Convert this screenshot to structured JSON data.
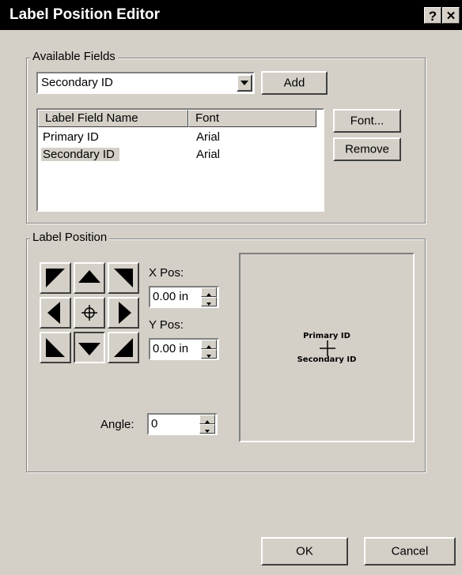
{
  "window": {
    "title": "Label Position Editor",
    "help_label": "?",
    "close_label": "✕"
  },
  "available_fields": {
    "group_label": "Available Fields",
    "selected": "Secondary ID",
    "add_label": "Add",
    "columns": [
      "Label Field Name",
      "Font"
    ],
    "rows": [
      {
        "name": "Primary ID",
        "font": "Arial"
      },
      {
        "name": "Secondary ID",
        "font": "Arial"
      }
    ],
    "font_button": "Font...",
    "remove_button": "Remove"
  },
  "label_position": {
    "group_label": "Label Position",
    "x_pos_label": "X Pos:",
    "x_pos_value": "0.00 in",
    "y_pos_label": "Y Pos:",
    "y_pos_value": "0.00 in",
    "angle_label": "Angle:",
    "angle_value": "0",
    "preview_primary": "Primary ID",
    "preview_secondary": "Secondary ID"
  },
  "footer": {
    "ok_label": "OK",
    "cancel_label": "Cancel"
  }
}
